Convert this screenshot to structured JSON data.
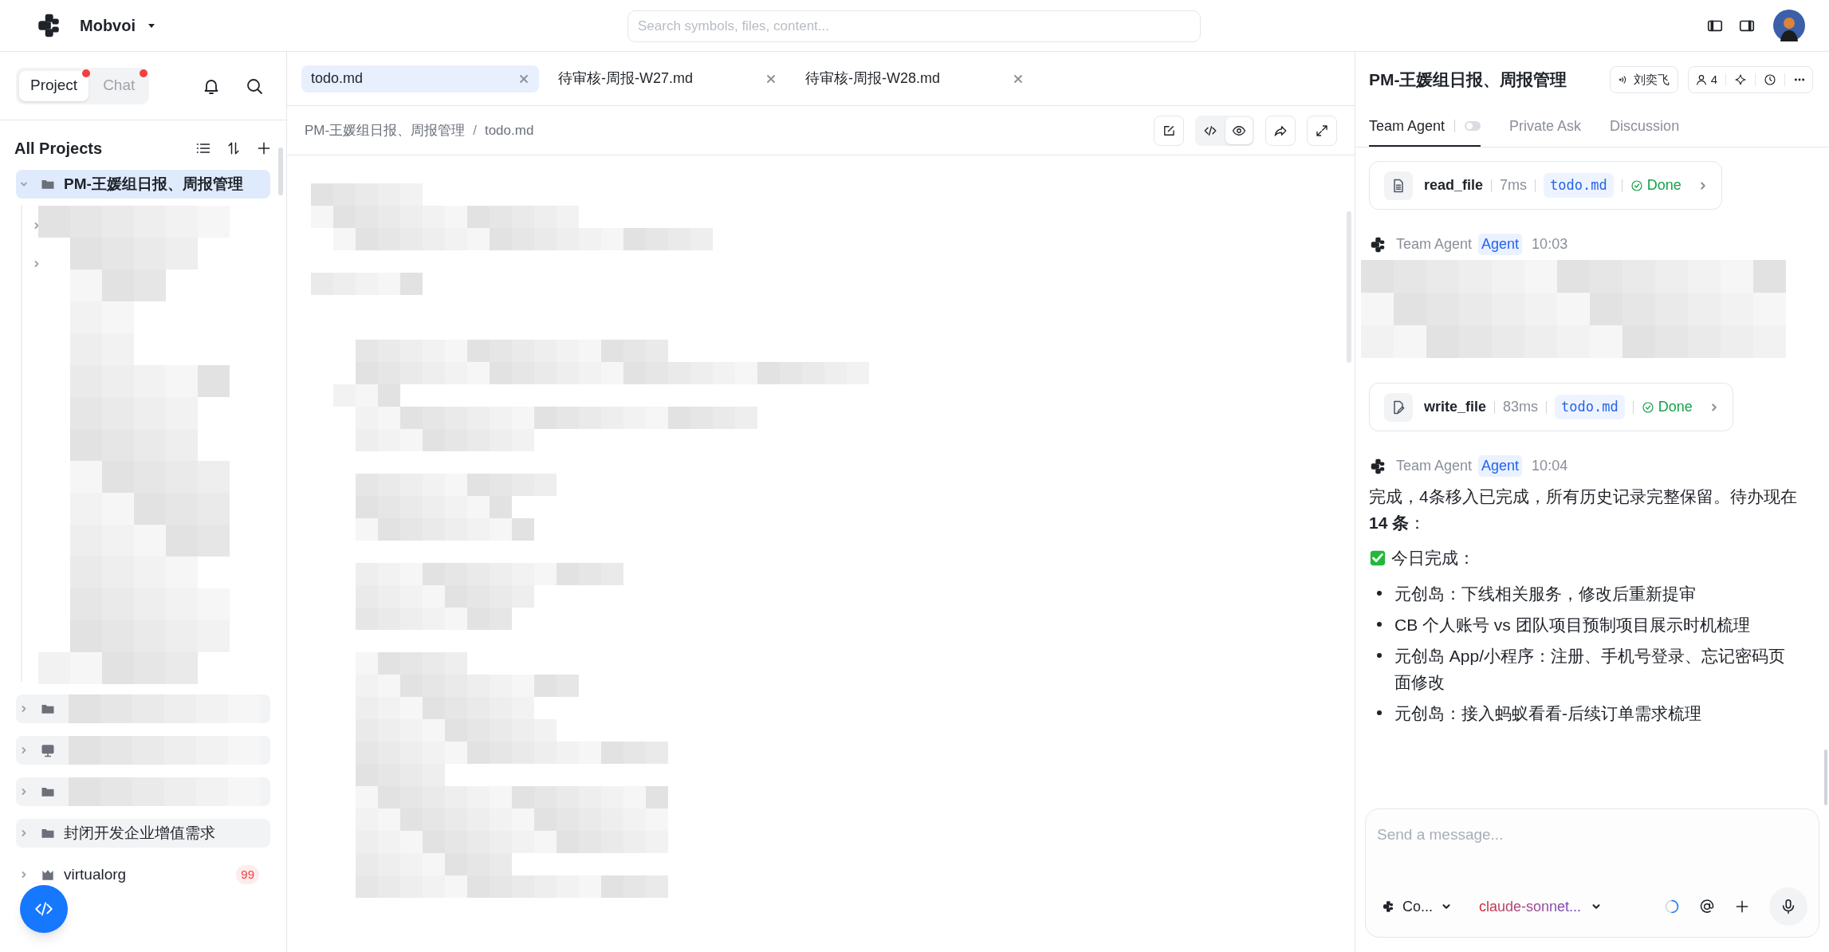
{
  "app": {
    "name": "Mobvoi"
  },
  "search": {
    "placeholder": "Search symbols, files, content..."
  },
  "sidebar": {
    "mode_tabs": [
      {
        "label": "Project",
        "selected": true,
        "unread": true
      },
      {
        "label": "Chat",
        "selected": false,
        "unread": true
      }
    ],
    "heading": "All Projects",
    "tree": [
      {
        "label": "PM-王媛组日报、周报管理",
        "kind": "project",
        "expanded": true,
        "selected": true,
        "children": [
          {
            "expanded": false
          },
          {
            "expanded": false
          }
        ]
      },
      {
        "kind": "project",
        "expanded": false,
        "selected": false
      },
      {
        "kind": "device",
        "expanded": false,
        "selected": false
      },
      {
        "kind": "project",
        "expanded": false,
        "selected": false
      },
      {
        "label": "封闭开发企业增值需求",
        "kind": "project",
        "expanded": false,
        "selected": false
      },
      {
        "label": "virtualorg",
        "kind": "organization",
        "expanded": false,
        "selected": false,
        "badge": "99"
      }
    ]
  },
  "editor": {
    "tabs": [
      {
        "label": "todo.md",
        "selected": true
      },
      {
        "label": "待审核-周报-W27.md",
        "selected": false
      },
      {
        "label": "待审核-周报-W28.md",
        "selected": false
      }
    ],
    "breadcrumb": [
      "PM-王媛组日报、周报管理",
      "todo.md"
    ],
    "breadcrumb_separator": "/",
    "view_modes": [
      {
        "kind": "code",
        "selected": false
      },
      {
        "kind": "preview",
        "selected": true
      }
    ]
  },
  "chat": {
    "title": "PM-王媛组日报、周报管理",
    "owner": "刘奕飞",
    "member_count": "4",
    "tabs": [
      {
        "label": "Team Agent",
        "selected": true
      },
      {
        "label": "Private Ask",
        "selected": false
      },
      {
        "label": "Discussion",
        "selected": false
      }
    ],
    "agent_toggle_on": false,
    "messages": [
      {
        "kind": "read",
        "tool": "read_file",
        "duration": "7ms",
        "file": "todo.md",
        "status": "Done"
      },
      {
        "kind": "agent",
        "sender": "Team Agent",
        "badge": "Agent",
        "time": "10:03",
        "redacted": true
      },
      {
        "kind": "write",
        "tool": "write_file",
        "duration": "83ms",
        "file": "todo.md",
        "status": "Done"
      },
      {
        "kind": "agent",
        "sender": "Team Agent",
        "badge": "Agent",
        "time": "10:04",
        "redacted": false,
        "paragraph": "完成，4条移入已完成，所有历史记录完整保留。待办现在 **14 条**：",
        "section": "今日完成：",
        "bullets": [
          "元创岛：下线相关服务，修改后重新提审",
          "CB 个人账号 vs 团队项目预制项目展示时机梳理",
          "元创岛 App/小程序：注册、手机号登录、忘记密码页面修改",
          "元创岛：接入蚂蚁看看-后续订单需求梳理"
        ]
      }
    ],
    "composer": {
      "placeholder": "Send a message...",
      "agent": "Co...",
      "model": "claude-sonnet..."
    }
  }
}
